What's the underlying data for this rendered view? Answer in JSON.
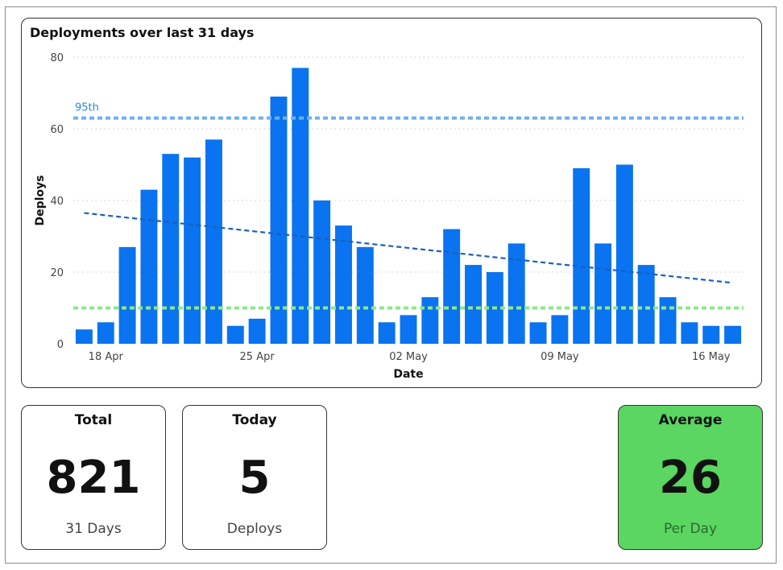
{
  "chart_data": {
    "type": "bar",
    "title": "Deployments over last 31 days",
    "xlabel": "Date",
    "ylabel": "Deploys",
    "ylim": [
      0,
      80
    ],
    "yticks": [
      0,
      20,
      40,
      60,
      80
    ],
    "x_tick_labels": [
      {
        "index": 1,
        "label": "18 Apr"
      },
      {
        "index": 8,
        "label": "25 Apr"
      },
      {
        "index": 15,
        "label": "02 May"
      },
      {
        "index": 22,
        "label": "09 May"
      },
      {
        "index": 29,
        "label": "16 May"
      }
    ],
    "values": [
      4,
      6,
      27,
      43,
      53,
      52,
      57,
      5,
      7,
      69,
      77,
      40,
      33,
      27,
      6,
      8,
      13,
      32,
      22,
      20,
      28,
      6,
      8,
      49,
      28,
      50,
      22,
      13,
      6,
      5,
      5
    ],
    "reference_lines": [
      {
        "label": "95th",
        "value": 63,
        "color": "#6fb0f2"
      },
      {
        "label": "",
        "value": 10,
        "color": "#8de88a"
      }
    ],
    "trend": {
      "start": 36.5,
      "end": 17
    },
    "grid": true,
    "bar_color": "#0a73f0",
    "trend_color": "#1a5fc2"
  },
  "kpis": {
    "total": {
      "title": "Total",
      "value": "821",
      "sub": "31 Days"
    },
    "today": {
      "title": "Today",
      "value": "5",
      "sub": "Deploys"
    },
    "average": {
      "title": "Average",
      "value": "26",
      "sub": "Per Day",
      "color": "#5ad661"
    }
  }
}
